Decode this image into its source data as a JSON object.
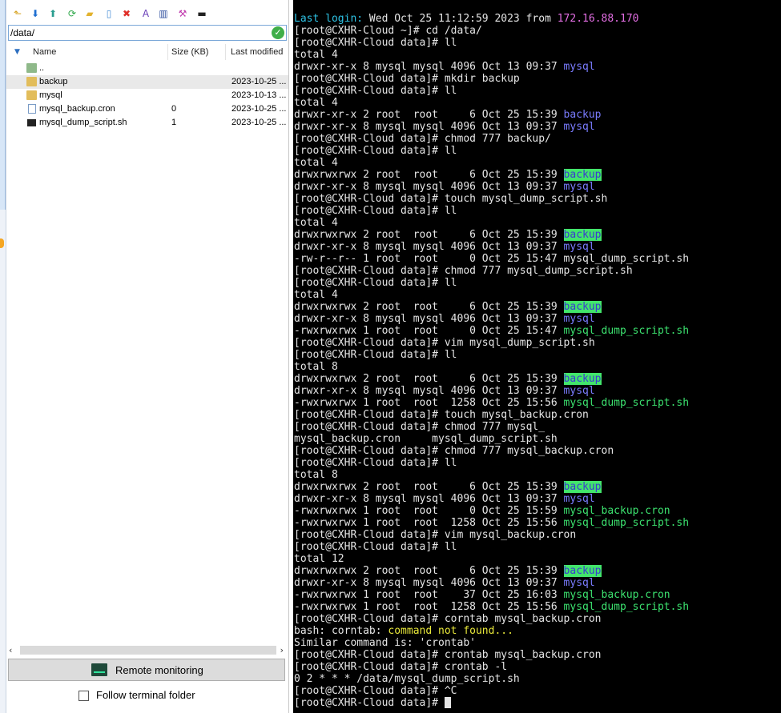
{
  "file_manager": {
    "toolbar": [
      {
        "icon": "folder-up-icon",
        "glyph": "⬑",
        "color": "#d6a21e"
      },
      {
        "icon": "download-icon",
        "glyph": "⬇",
        "color": "#1f6fd1"
      },
      {
        "icon": "upload-icon",
        "glyph": "⬆",
        "color": "#2a9d8f"
      },
      {
        "icon": "refresh-icon",
        "glyph": "⟳",
        "color": "#2fa84a"
      },
      {
        "icon": "new-folder-icon",
        "glyph": "▰",
        "color": "#e2b22e"
      },
      {
        "icon": "new-file-icon",
        "glyph": "▯",
        "color": "#4a8fd6"
      },
      {
        "icon": "delete-icon",
        "glyph": "✖",
        "color": "#e0302a"
      },
      {
        "icon": "rename-icon",
        "glyph": "A",
        "color": "#6a3fb8"
      },
      {
        "icon": "properties-icon",
        "glyph": "▥",
        "color": "#2f4f9e"
      },
      {
        "icon": "edit-wand-icon",
        "glyph": "⚒",
        "color": "#c23fb0"
      },
      {
        "icon": "terminal-icon",
        "glyph": "▬",
        "color": "#222222"
      }
    ],
    "path": "/data/",
    "columns": {
      "name": "Name",
      "size": "Size (KB)",
      "modified": "Last modified"
    },
    "rows": [
      {
        "name": "..",
        "size": "",
        "modified": "",
        "type": "up"
      },
      {
        "name": "backup",
        "size": "",
        "modified": "2023-10-25 ...",
        "type": "folder",
        "selected": true
      },
      {
        "name": "mysql",
        "size": "",
        "modified": "2023-10-13 ...",
        "type": "folder"
      },
      {
        "name": "mysql_backup.cron",
        "size": "0",
        "modified": "2023-10-25 ...",
        "type": "file"
      },
      {
        "name": "mysql_dump_script.sh",
        "size": "1",
        "modified": "2023-10-25 ...",
        "type": "script"
      }
    ],
    "remote_monitoring_label": "Remote monitoring",
    "follow_terminal_label": "Follow terminal folder",
    "follow_terminal_checked": false
  },
  "terminal": {
    "lines": [
      [
        {
          "t": "Last login: ",
          "c": "cyan"
        },
        {
          "t": "Wed Oct 25 11:12:59 2023",
          "c": "white"
        },
        {
          "t": " from ",
          "c": "white"
        },
        {
          "t": "172.16.88.170",
          "c": "magenta"
        }
      ],
      [
        {
          "t": "[root@CXHR-Cloud ~]# cd /data/",
          "c": "white"
        }
      ],
      [
        {
          "t": "[root@CXHR-Cloud data]# ll",
          "c": "white"
        }
      ],
      [
        {
          "t": "total 4",
          "c": "white"
        }
      ],
      [
        {
          "t": "drwxr-xr-x 8 mysql mysql 4096 Oct 13 09:37 ",
          "c": "white"
        },
        {
          "t": "mysql",
          "c": "blue"
        }
      ],
      [
        {
          "t": "[root@CXHR-Cloud data]# mkdir backup",
          "c": "white"
        }
      ],
      [
        {
          "t": "[root@CXHR-Cloud data]# ll",
          "c": "white"
        }
      ],
      [
        {
          "t": "total 4",
          "c": "white"
        }
      ],
      [
        {
          "t": "drwxr-xr-x 2 root  root     6 Oct 25 15:39 ",
          "c": "white"
        },
        {
          "t": "backup",
          "c": "blue"
        }
      ],
      [
        {
          "t": "drwxr-xr-x 8 mysql mysql 4096 Oct 13 09:37 ",
          "c": "white"
        },
        {
          "t": "mysql",
          "c": "blue"
        }
      ],
      [
        {
          "t": "[root@CXHR-Cloud data]# chmod 777 backup/",
          "c": "white"
        }
      ],
      [
        {
          "t": "[root@CXHR-Cloud data]# ll",
          "c": "white"
        }
      ],
      [
        {
          "t": "total 4",
          "c": "white"
        }
      ],
      [
        {
          "t": "drwxrwxrwx 2 root  root     6 Oct 25 15:39 ",
          "c": "white"
        },
        {
          "t": "backup",
          "c": "hl"
        }
      ],
      [
        {
          "t": "drwxr-xr-x 8 mysql mysql 4096 Oct 13 09:37 ",
          "c": "white"
        },
        {
          "t": "mysql",
          "c": "blue"
        }
      ],
      [
        {
          "t": "[root@CXHR-Cloud data]# touch mysql_dump_script.sh",
          "c": "white"
        }
      ],
      [
        {
          "t": "[root@CXHR-Cloud data]# ll",
          "c": "white"
        }
      ],
      [
        {
          "t": "total 4",
          "c": "white"
        }
      ],
      [
        {
          "t": "drwxrwxrwx 2 root  root     6 Oct 25 15:39 ",
          "c": "white"
        },
        {
          "t": "backup",
          "c": "hl"
        }
      ],
      [
        {
          "t": "drwxr-xr-x 8 mysql mysql 4096 Oct 13 09:37 ",
          "c": "white"
        },
        {
          "t": "mysql",
          "c": "blue"
        }
      ],
      [
        {
          "t": "-rw-r--r-- 1 root  root     0 Oct 25 15:47 mysql_dump_script.sh",
          "c": "white"
        }
      ],
      [
        {
          "t": "[root@CXHR-Cloud data]# chmod 777 mysql_dump_script.sh",
          "c": "white"
        }
      ],
      [
        {
          "t": "[root@CXHR-Cloud data]# ll",
          "c": "white"
        }
      ],
      [
        {
          "t": "total 4",
          "c": "white"
        }
      ],
      [
        {
          "t": "drwxrwxrwx 2 root  root     6 Oct 25 15:39 ",
          "c": "white"
        },
        {
          "t": "backup",
          "c": "hl"
        }
      ],
      [
        {
          "t": "drwxr-xr-x 8 mysql mysql 4096 Oct 13 09:37 ",
          "c": "white"
        },
        {
          "t": "mysql",
          "c": "blue"
        }
      ],
      [
        {
          "t": "-rwxrwxrwx 1 root  root     0 Oct 25 15:47 ",
          "c": "white"
        },
        {
          "t": "mysql_dump_script.sh",
          "c": "green"
        }
      ],
      [
        {
          "t": "[root@CXHR-Cloud data]# vim mysql_dump_script.sh",
          "c": "white"
        }
      ],
      [
        {
          "t": "[root@CXHR-Cloud data]# ll",
          "c": "white"
        }
      ],
      [
        {
          "t": "total 8",
          "c": "white"
        }
      ],
      [
        {
          "t": "drwxrwxrwx 2 root  root     6 Oct 25 15:39 ",
          "c": "white"
        },
        {
          "t": "backup",
          "c": "hl"
        }
      ],
      [
        {
          "t": "drwxr-xr-x 8 mysql mysql 4096 Oct 13 09:37 ",
          "c": "white"
        },
        {
          "t": "mysql",
          "c": "blue"
        }
      ],
      [
        {
          "t": "-rwxrwxrwx 1 root  root  1258 Oct 25 15:56 ",
          "c": "white"
        },
        {
          "t": "mysql_dump_script.sh",
          "c": "green"
        }
      ],
      [
        {
          "t": "[root@CXHR-Cloud data]# touch mysql_backup.cron",
          "c": "white"
        }
      ],
      [
        {
          "t": "[root@CXHR-Cloud data]# chmod 777 mysql_",
          "c": "white"
        }
      ],
      [
        {
          "t": "mysql_backup.cron     mysql_dump_script.sh",
          "c": "white"
        }
      ],
      [
        {
          "t": "[root@CXHR-Cloud data]# chmod 777 mysql_backup.cron",
          "c": "white"
        }
      ],
      [
        {
          "t": "[root@CXHR-Cloud data]# ll",
          "c": "white"
        }
      ],
      [
        {
          "t": "total 8",
          "c": "white"
        }
      ],
      [
        {
          "t": "drwxrwxrwx 2 root  root     6 Oct 25 15:39 ",
          "c": "white"
        },
        {
          "t": "backup",
          "c": "hl"
        }
      ],
      [
        {
          "t": "drwxr-xr-x 8 mysql mysql 4096 Oct 13 09:37 ",
          "c": "white"
        },
        {
          "t": "mysql",
          "c": "blue"
        }
      ],
      [
        {
          "t": "-rwxrwxrwx 1 root  root     0 Oct 25 15:59 ",
          "c": "white"
        },
        {
          "t": "mysql_backup.cron",
          "c": "green"
        }
      ],
      [
        {
          "t": "-rwxrwxrwx 1 root  root  1258 Oct 25 15:56 ",
          "c": "white"
        },
        {
          "t": "mysql_dump_script.sh",
          "c": "green"
        }
      ],
      [
        {
          "t": "[root@CXHR-Cloud data]# vim mysql_backup.cron",
          "c": "white"
        }
      ],
      [
        {
          "t": "[root@CXHR-Cloud data]# ll",
          "c": "white"
        }
      ],
      [
        {
          "t": "total 12",
          "c": "white"
        }
      ],
      [
        {
          "t": "drwxrwxrwx 2 root  root     6 Oct 25 15:39 ",
          "c": "white"
        },
        {
          "t": "backup",
          "c": "hl"
        }
      ],
      [
        {
          "t": "drwxr-xr-x 8 mysql mysql 4096 Oct 13 09:37 ",
          "c": "white"
        },
        {
          "t": "mysql",
          "c": "blue"
        }
      ],
      [
        {
          "t": "-rwxrwxrwx 1 root  root    37 Oct 25 16:03 ",
          "c": "white"
        },
        {
          "t": "mysql_backup.cron",
          "c": "green"
        }
      ],
      [
        {
          "t": "-rwxrwxrwx 1 root  root  1258 Oct 25 15:56 ",
          "c": "white"
        },
        {
          "t": "mysql_dump_script.sh",
          "c": "green"
        }
      ],
      [
        {
          "t": "[root@CXHR-Cloud data]# corntab mysql_backup.cron",
          "c": "white"
        }
      ],
      [
        {
          "t": "bash: corntab: ",
          "c": "white"
        },
        {
          "t": "command not found...",
          "c": "yellow"
        }
      ],
      [
        {
          "t": "Similar command is: 'crontab'",
          "c": "white"
        }
      ],
      [
        {
          "t": "[root@CXHR-Cloud data]# crontab mysql_backup.cron",
          "c": "white"
        }
      ],
      [
        {
          "t": "[root@CXHR-Cloud data]# crontab -l",
          "c": "white"
        }
      ],
      [
        {
          "t": "0 2 * * * /data/mysql_dump_script.sh",
          "c": "white"
        }
      ],
      [
        {
          "t": "[root@CXHR-Cloud data]# ^C",
          "c": "white"
        }
      ],
      [
        {
          "t": "[root@CXHR-Cloud data]# ",
          "c": "white"
        }
      ]
    ]
  },
  "colors": {
    "terminal_bg": "#000000",
    "terminal_fg": "#e5e5e5",
    "cyan": "#2ec4e6",
    "magenta": "#e36ee3",
    "dir_blue": "#7a7cff",
    "exec_green": "#3ce26f",
    "highlight_bg": "#42e56b",
    "warning_yellow": "#e8e83a"
  }
}
